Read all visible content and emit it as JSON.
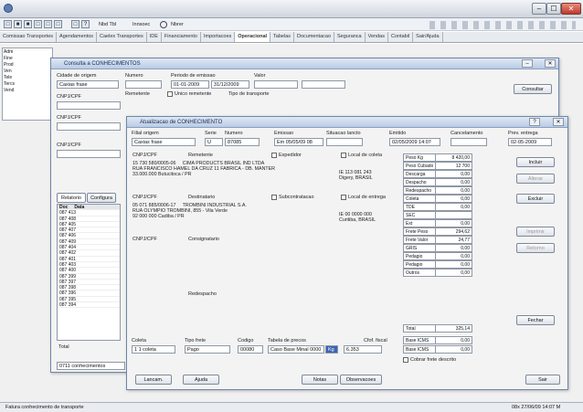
{
  "window": {
    "minimize": "‒",
    "maximize": "☐",
    "close": "✕"
  },
  "toolbar": {
    "icons": [
      "□",
      "■",
      "■",
      "□",
      "□",
      "□",
      "□",
      "?"
    ],
    "menu1": "Nbd Tbl",
    "menu2": "Innsoec",
    "menu3": "Nbrer"
  },
  "tabs": [
    "Comissao Transportes",
    "Agendamentos",
    "Caelex Transportes",
    "IDE",
    "Financiamento",
    "Importacoes",
    "Operacional",
    "Tabelas",
    "Documentacao",
    "Seguranca",
    "Vendas",
    "Contabil",
    "Sair/Ajuda"
  ],
  "active_tab": 6,
  "tree": [
    "Adm",
    "Fine",
    "Prod",
    "Ven",
    "Tele",
    "Tercs",
    "Vend"
  ],
  "back_window": {
    "title": "Consulta a CONHECIMENTOS",
    "l_origem": "Cidade de origem",
    "v_origem": "Caxias frase",
    "l_numero": "Numero",
    "l_periodo": "Periodo de emissao",
    "v_date1": "01-01-2009",
    "v_date2": "31/12/2009",
    "l_valor": "Valor",
    "l_remetente": "Remetente",
    "l_destinatario": "Destinatario",
    "l_unico": "Unico remetente",
    "l_tipo": "Tipo de transporte",
    "l_cnpj": "CNPJ/CPF",
    "consultar": "Consultar",
    "tab1": "Relatorio",
    "tab2": "Configura",
    "col1": "Doc",
    "col2": "Data",
    "rows": [
      "087 413",
      "087 408",
      "087 405",
      "087 407",
      "087 406",
      "087 409",
      "087 404",
      "087 402",
      "087 401",
      "087 403",
      "087 400",
      "087 399",
      "087 397",
      "087 398",
      "087 396",
      "087 395",
      "087 394"
    ],
    "total": "Total",
    "status": "0711 conhecimentos"
  },
  "front_window": {
    "title": "Atualizacao de CONHECIMENTO",
    "l_filial": "Filial origem",
    "v_filial": "Caxias frase",
    "l_serie": "Serie",
    "v_serie": "U",
    "l_numero": "Numero",
    "v_numero": "87085",
    "l_emissao": "Emissao",
    "v_emissao": "Em 05/05/09 08",
    "l_situacao": "Situacao lancto",
    "l_emitido": "Emitido",
    "v_emitido": "02/05/2009 14:07",
    "l_cancelamento": "Cancelamento",
    "l_prev": "Prev. entrega",
    "v_prev": "02-05-2009",
    "l_cnpj": "CNPJ/CPF",
    "l_remetente": "Remetente",
    "l_expedidor": "Expedidor",
    "l_local_coleta": "Local de coleta",
    "rem_text": "15 730 580/0005-06     CIMA PRODUCTS BRASIL IND LTDA\nRUA FRANCISCO HAMEL DA CRUZ 11 FABRICA - DB. MANTER\n33.000.000 Butucitoca / PR",
    "rem_ie": "IE 113 081 243\nDigery, BRASIL",
    "l_destinatario": "Destinatario",
    "l_subcontratacao": "Subcontratacao",
    "l_local_entrega": "Local de entrega",
    "dest_text": "05 071 885/0006-17     TROMBINI INDUSTRIAL S.A.\nRUA OLYMPIO TROMBINI, 855 - Vila Verde\n92 000 000 Cadiba / PR",
    "dest_ie": "IE 00 0000 000\nCuritiba, BRASIL",
    "l_consignatario": "Consignatario",
    "l_redespacho": "Redespacho",
    "l_coleta": "Coleta",
    "v_coleta": "1 1 coleta",
    "l_tipo_frete": "Tipo frete",
    "v_tipo_frete": "Pago",
    "l_codigo": "Codigo",
    "v_codigo": "00080",
    "l_tabela": "Tabela de precos",
    "v_tabela": "Caso Base Minal 0000",
    "v_kg": "Kg",
    "l_cfop": "Cfof. fiscal",
    "v_cfop": "6.353",
    "summary": [
      {
        "label": "Peso Kg",
        "value": "8 420,00"
      },
      {
        "label": "Peso Cubado",
        "value": "12 700"
      },
      {
        "label": "Descarga",
        "value": "0,00"
      },
      {
        "label": "Despacho",
        "value": "0,00"
      },
      {
        "label": "Redespacho",
        "value": "0,00"
      },
      {
        "label": "Coleta",
        "value": "0,00"
      },
      {
        "label": "TDE",
        "value": "0,00"
      },
      {
        "label": "SEC",
        "value": ""
      },
      {
        "label": "Ext",
        "value": "0,00"
      },
      {
        "label": "Frete Peso",
        "value": "294,62"
      },
      {
        "label": "Frete Valor",
        "value": "24,77"
      },
      {
        "label": "GRIS",
        "value": "0,00"
      },
      {
        "label": "Pedagio",
        "value": "0,00"
      },
      {
        "label": "Pedagio",
        "value": "0,00"
      },
      {
        "label": "Outros",
        "value": "0,00"
      }
    ],
    "total_label": "Total",
    "total_value": "325,14",
    "icms_label": "Base ICMS",
    "icms_value": "0,00",
    "icms_label2": "Base ICMS",
    "icms_value2": "0,00",
    "l_cobrar": "Cobrar frete descrito",
    "btn_incluir": "Incluir",
    "btn_alterar": "Alterar",
    "btn_excluir": "Excluir",
    "btn_imprimir": "Imprimir",
    "btn_retorno": "Retorno",
    "btn_fechar": "Fechar",
    "btn_lancamentos": "Lancam.",
    "btn_ajuda": "Ajuda",
    "btn_notas": "Notas",
    "btn_observacoes": "Observacoes",
    "btn_sair": "Sair"
  },
  "statusbar": {
    "left": "Fatura conhecimento de transporte",
    "right": "08x 27/06/09 14:07 M"
  }
}
